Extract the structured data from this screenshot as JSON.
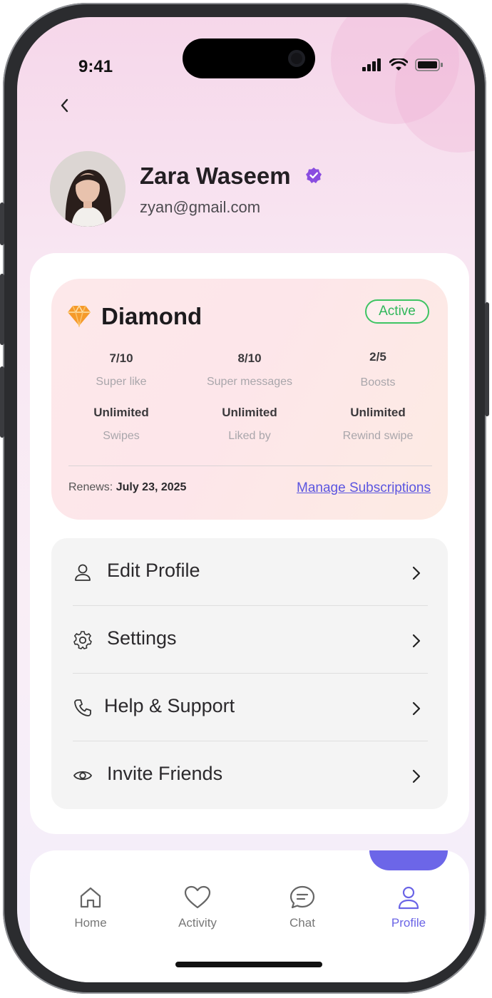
{
  "status_bar": {
    "time": "9:41"
  },
  "profile": {
    "name": "Zara Waseem",
    "email": "zyan@gmail.com"
  },
  "plan": {
    "name": "Diamond",
    "status": "Active",
    "stats": [
      {
        "value": "7/10",
        "label": "Super like"
      },
      {
        "value": "8/10",
        "label": "Super messages"
      },
      {
        "value": "2/5",
        "label": "Boosts"
      },
      {
        "value": "Unlimited",
        "label": "Swipes"
      },
      {
        "value": "Unlimited",
        "label": "Liked by"
      },
      {
        "value": "Unlimited",
        "label": "Rewind swipe"
      }
    ],
    "renews_label": "Renews:",
    "renews_date": "July 23, 2025",
    "manage_label": "Manage Subscriptions"
  },
  "menu": {
    "items": [
      {
        "label": "Edit Profile",
        "icon": "user-icon"
      },
      {
        "label": "Settings",
        "icon": "gear-icon"
      },
      {
        "label": "Help & Support",
        "icon": "phone-icon"
      },
      {
        "label": "Invite Friends",
        "icon": "eye-icon"
      }
    ]
  },
  "tabbar": {
    "tabs": [
      {
        "label": "Home",
        "icon": "home-icon"
      },
      {
        "label": "Activity",
        "icon": "heart-icon"
      },
      {
        "label": "Chat",
        "icon": "chat-icon"
      },
      {
        "label": "Profile",
        "icon": "user-icon"
      }
    ],
    "active": "Profile"
  },
  "colors": {
    "accent": "#6a64e6",
    "active_green": "#3ec463",
    "verified_purple": "#8a4de0",
    "diamond_orange": "#f59a2a"
  }
}
